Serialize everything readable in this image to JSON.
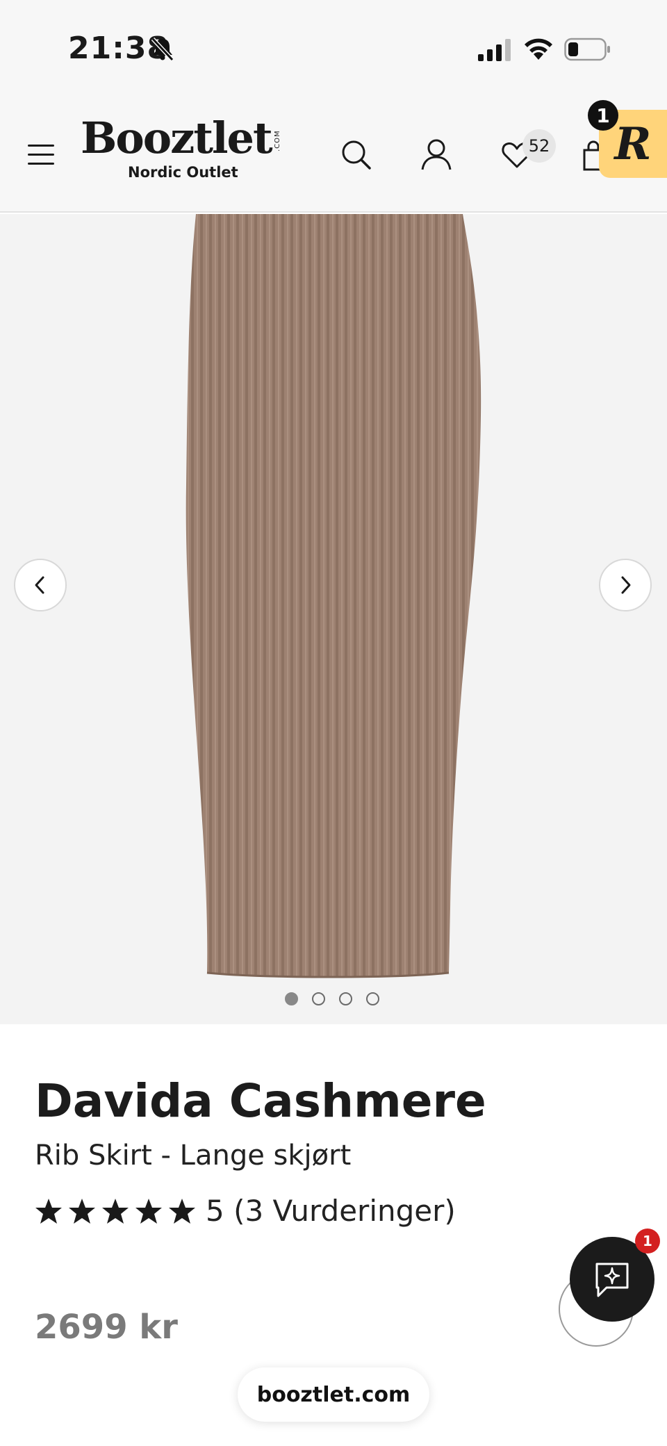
{
  "status_bar": {
    "time": "21:38",
    "icons": [
      "bell-slash-icon",
      "cellular-signal-icon",
      "wifi-icon",
      "battery-icon"
    ]
  },
  "header": {
    "menu_icon": "hamburger-menu-icon",
    "logo": {
      "name": "Booztlet",
      "domain_suffix": ".COM",
      "tagline": "Nordic Outlet"
    },
    "search_icon": "search-icon",
    "account_icon": "user-icon",
    "wishlist": {
      "icon": "heart-icon",
      "count": "52"
    },
    "cart_icon": "shopping-bag-icon",
    "rewards": {
      "letter": "R",
      "count": "1",
      "color": "#ffd47a"
    }
  },
  "gallery": {
    "prev_icon": "chevron-left-icon",
    "next_icon": "chevron-right-icon",
    "image_count": 4,
    "active_index": 0,
    "product_color": "#9e8272"
  },
  "product": {
    "brand": "Davida Cashmere",
    "name": "Rib Skirt - Lange skjørt",
    "rating_stars": 5,
    "rating_text": "5 (3 Vurderinger)",
    "price": "2699 kr"
  },
  "chat": {
    "icon": "chat-sparkle-icon",
    "badge": "1",
    "badge_color": "#d32020"
  },
  "browser": {
    "url": "booztlet.com"
  }
}
